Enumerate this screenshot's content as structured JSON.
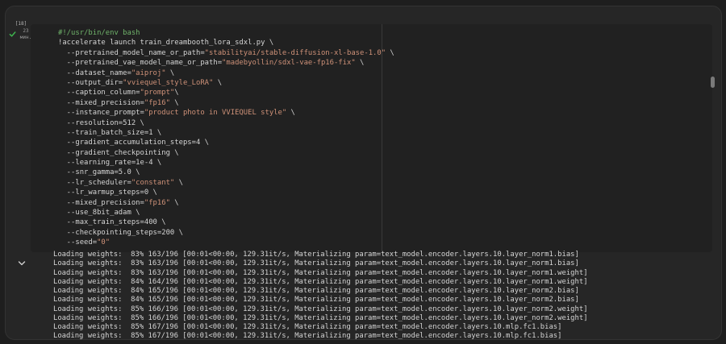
{
  "cell": {
    "execution_count": "[18]",
    "duration": "23\nмин.",
    "status": "completed",
    "code_lines": [
      [
        {
          "t": "#!/usr/bin/env bash",
          "c": "comment"
        }
      ],
      [
        {
          "t": "!accelerate launch train_dreambooth_lora_sdxl.py \\"
        }
      ],
      [
        {
          "t": "  --pretrained_model_name_or_path="
        },
        {
          "t": "\"stabilityai/stable-diffusion-xl-base-1.0\"",
          "c": "str"
        },
        {
          "t": " \\"
        }
      ],
      [
        {
          "t": "  --pretrained_vae_model_name_or_path="
        },
        {
          "t": "\"madebyollin/sdxl-vae-fp16-fix\"",
          "c": "str"
        },
        {
          "t": " \\"
        }
      ],
      [
        {
          "t": "  --dataset_name="
        },
        {
          "t": "\"aiproj\"",
          "c": "str"
        },
        {
          "t": " \\"
        }
      ],
      [
        {
          "t": "  --output_dir="
        },
        {
          "t": "\"vviequel_style_LoRA\"",
          "c": "str"
        },
        {
          "t": " \\"
        }
      ],
      [
        {
          "t": "  --caption_column="
        },
        {
          "t": "\"prompt\"",
          "c": "str"
        },
        {
          "t": "\\"
        }
      ],
      [
        {
          "t": "  --mixed_precision="
        },
        {
          "t": "\"fp16\"",
          "c": "str"
        },
        {
          "t": " \\"
        }
      ],
      [
        {
          "t": "  --instance_prompt="
        },
        {
          "t": "\"product photo in VVIEQUEL style\"",
          "c": "str"
        },
        {
          "t": " \\"
        }
      ],
      [
        {
          "t": "  --resolution=512 \\"
        }
      ],
      [
        {
          "t": "  --train_batch_size=1 \\"
        }
      ],
      [
        {
          "t": "  --gradient_accumulation_steps=4 \\"
        }
      ],
      [
        {
          "t": "  --gradient_checkpointing \\"
        }
      ],
      [
        {
          "t": "  --learning_rate=1e-4 \\"
        }
      ],
      [
        {
          "t": "  --snr_gamma=5.0 \\"
        }
      ],
      [
        {
          "t": "  --lr_scheduler="
        },
        {
          "t": "\"constant\"",
          "c": "str"
        },
        {
          "t": " \\"
        }
      ],
      [
        {
          "t": "  --lr_warmup_steps=0 \\"
        }
      ],
      [
        {
          "t": "  --mixed_precision="
        },
        {
          "t": "\"fp16\"",
          "c": "str"
        },
        {
          "t": " \\"
        }
      ],
      [
        {
          "t": "  --use_8bit_adam \\"
        }
      ],
      [
        {
          "t": "  --max_train_steps=400 \\"
        }
      ],
      [
        {
          "t": "  --checkpointing_steps=200 \\"
        }
      ],
      [
        {
          "t": "  --seed="
        },
        {
          "t": "\"0\"",
          "c": "str"
        }
      ]
    ],
    "output_lines": [
      "Loading weights:  83% 163/196 [00:01<00:00, 129.31it/s, Materializing param=text_model.encoder.layers.10.layer_norm1.bias]",
      "Loading weights:  83% 163/196 [00:01<00:00, 129.31it/s, Materializing param=text_model.encoder.layers.10.layer_norm1.bias]",
      "Loading weights:  83% 163/196 [00:01<00:00, 129.31it/s, Materializing param=text_model.encoder.layers.10.layer_norm1.weight]",
      "Loading weights:  84% 164/196 [00:01<00:00, 129.31it/s, Materializing param=text_model.encoder.layers.10.layer_norm1.weight]",
      "Loading weights:  84% 165/196 [00:01<00:00, 129.31it/s, Materializing param=text_model.encoder.layers.10.layer_norm2.bias]",
      "Loading weights:  84% 165/196 [00:01<00:00, 129.31it/s, Materializing param=text_model.encoder.layers.10.layer_norm2.bias]",
      "Loading weights:  85% 166/196 [00:01<00:00, 129.31it/s, Materializing param=text_model.encoder.layers.10.layer_norm2.weight]",
      "Loading weights:  85% 166/196 [00:01<00:00, 129.31it/s, Materializing param=text_model.encoder.layers.10.layer_norm2.weight]",
      "Loading weights:  85% 167/196 [00:01<00:00, 129.31it/s, Materializing param=text_model.encoder.layers.10.mlp.fc1.bias]",
      "Loading weights:  85% 167/196 [00:01<00:00, 129.31it/s, Materializing param=text_model.encoder.layers.10.mlp.fc1.bias]"
    ]
  },
  "colors": {
    "background": "#1e1e1e",
    "cell": "#262626",
    "editor": "#212121",
    "text": "#d4d4d4",
    "comment": "#6fb36a",
    "string": "#ce9178",
    "success": "#3fb950"
  },
  "icons": {
    "status": "check-icon",
    "toggle": "chevron-down-icon"
  }
}
